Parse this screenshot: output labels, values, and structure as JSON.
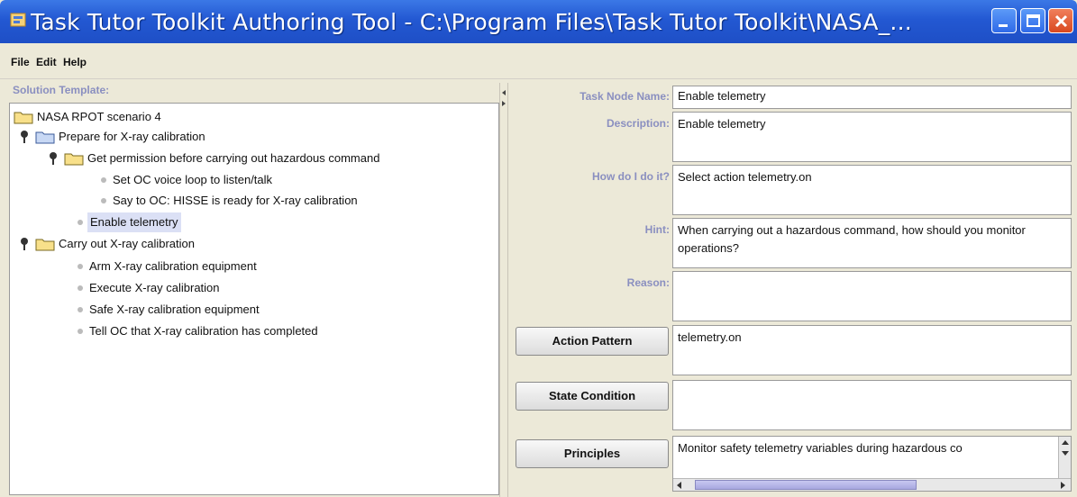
{
  "window": {
    "title": "Task Tutor Toolkit Authoring Tool - C:\\Program Files\\Task Tutor Toolkit\\NASA_..."
  },
  "menu": [
    "File",
    "Edit",
    "Help"
  ],
  "left": {
    "label": "Solution Template:",
    "tree": [
      {
        "text": "NASA RPOT scenario 4"
      },
      {
        "text": "Prepare for X-ray calibration"
      },
      {
        "text": "Get permission before carrying out hazardous command"
      },
      {
        "text": "Set OC voice loop to listen/talk"
      },
      {
        "text": "Say to OC: HISSE is ready for X-ray calibration"
      },
      {
        "text": "Enable telemetry"
      },
      {
        "text": "Carry out X-ray calibration"
      },
      {
        "text": "Arm X-ray calibration equipment"
      },
      {
        "text": "Execute X-ray calibration"
      },
      {
        "text": "Safe X-ray calibration equipment"
      },
      {
        "text": "Tell OC that X-ray calibration has completed"
      }
    ]
  },
  "form": {
    "task_node_name": {
      "label": "Task Node Name:",
      "value": "Enable telemetry"
    },
    "description": {
      "label": "Description:",
      "value": "Enable telemetry"
    },
    "how": {
      "label": "How do I do it?",
      "value": "Select action telemetry.on"
    },
    "hint": {
      "label": "Hint:",
      "value": "When carrying out a hazardous command, how should you monitor operations?"
    },
    "reason": {
      "label": "Reason:",
      "value": ""
    },
    "action_pattern": {
      "button": "Action Pattern",
      "value": "telemetry.on"
    },
    "state_condition": {
      "button": "State Condition",
      "value": ""
    },
    "principles": {
      "button": "Principles",
      "value": "Monitor safety telemetry variables during hazardous co"
    }
  },
  "colors": {
    "titlebar": "#2358d2",
    "label": "#8a8fc0",
    "selection": "#dbe0f5"
  }
}
